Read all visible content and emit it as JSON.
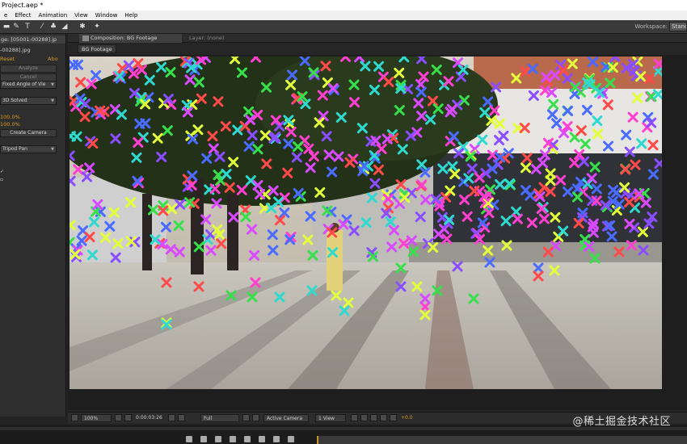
{
  "window": {
    "title": "Project.aep *"
  },
  "menu": {
    "items": [
      "e",
      "Effect",
      "Animation",
      "View",
      "Window",
      "Help"
    ]
  },
  "toolbar": {
    "workspace_label": "Workspace:",
    "workspace_value": "Standard"
  },
  "left_panel": {
    "tab_label": "ge: [05001-00288].jp",
    "layer_label": "-00288].jpg",
    "reset_label": "Reset",
    "about_label": "Abo",
    "analyze_button": "Analyze",
    "cancel_button": "Cancel",
    "shot_type": "Fixed Angle of Vie",
    "solve_method": "3D Solved",
    "value_1": "100.0%",
    "value_2": "100.0%",
    "create_camera_button": "Create Camera",
    "solve_mode": "Tripod Pan"
  },
  "composition": {
    "tab_label": "Composition: BG Footage",
    "layer_tab_label": "Layer: (none)",
    "subtab_label": "BG Footage"
  },
  "viewer_toolbar": {
    "zoom": "100%",
    "timecode": "0:00:03:26",
    "resolution": "Full",
    "camera": "Active Camera",
    "views": "1 View",
    "exposure": "+0.0"
  },
  "colors": {
    "accent_orange": "#d89b22",
    "panel_bg": "#2e2e2e",
    "dark_bg": "#232323"
  },
  "watermark": "@稀土掘金技术社区"
}
